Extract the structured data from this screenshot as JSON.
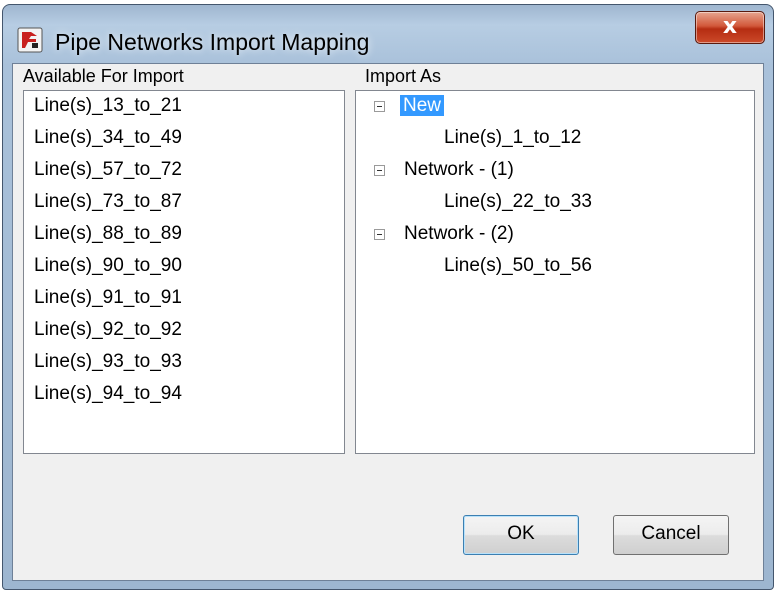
{
  "window": {
    "title": "Pipe Networks Import Mapping",
    "close_label": "x"
  },
  "left_panel": {
    "label": "Available For Import",
    "items": [
      "Line(s)_13_to_21",
      "Line(s)_34_to_49",
      "Line(s)_57_to_72",
      "Line(s)_73_to_87",
      "Line(s)_88_to_89",
      "Line(s)_90_to_90",
      "Line(s)_91_to_91",
      "Line(s)_92_to_92",
      "Line(s)_93_to_93",
      "Line(s)_94_to_94"
    ]
  },
  "right_panel": {
    "label": "Import As",
    "tree": [
      {
        "label": "New",
        "selected": true,
        "children": [
          "Line(s)_1_to_12"
        ]
      },
      {
        "label": "Network - (1)",
        "selected": false,
        "children": [
          "Line(s)_22_to_33"
        ]
      },
      {
        "label": "Network - (2)",
        "selected": false,
        "children": [
          "Line(s)_50_to_56"
        ]
      }
    ]
  },
  "buttons": {
    "ok": "OK",
    "cancel": "Cancel"
  },
  "icons": {
    "app": "app-logo-icon",
    "close": "close-icon",
    "collapse": "collapse-minus-icon"
  },
  "colors": {
    "selection": "#3399ff",
    "close_button": "#c9412b"
  }
}
